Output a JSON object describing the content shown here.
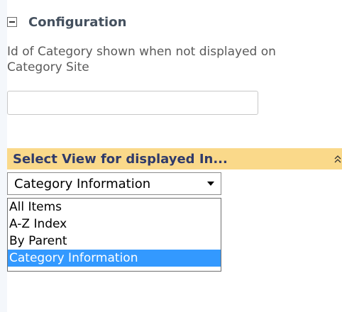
{
  "configuration": {
    "title": "Configuration",
    "collapse_icon": "minus-box-icon",
    "category_id_label": "Id of Category shown when not displayed on Category Site",
    "category_id_value": ""
  },
  "view_section": {
    "title": "Select View for displayed In...",
    "chevron_icon": "double-chevron-up-icon",
    "header_color": "#fad98a"
  },
  "view_select": {
    "selected": "Category Information",
    "options": [
      "All Items",
      "A-Z Index",
      "By Parent",
      "Category Information"
    ],
    "highlight_color": "#3399ff"
  }
}
